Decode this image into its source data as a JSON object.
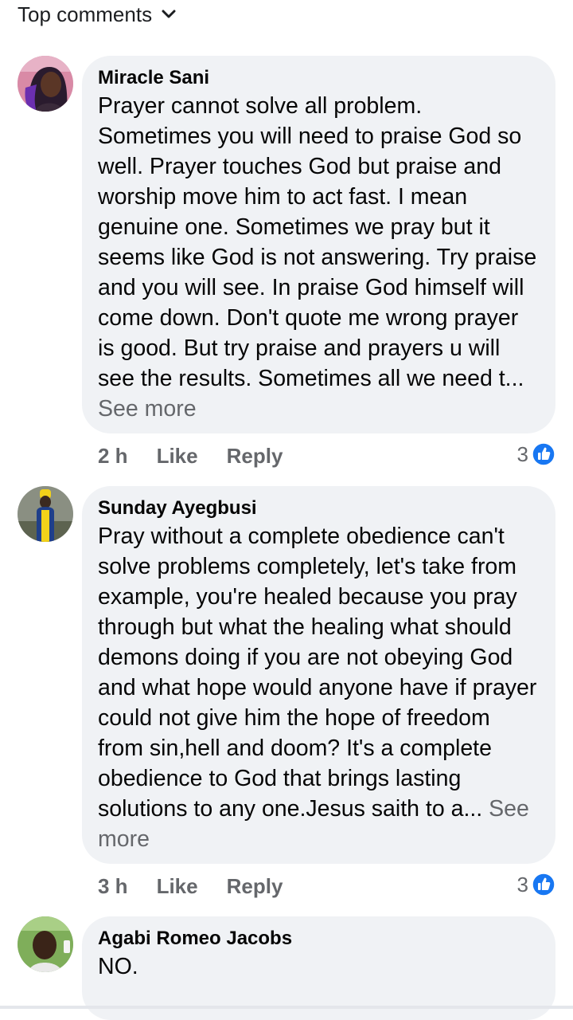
{
  "header": {
    "sort_label": "Top comments"
  },
  "comments": [
    {
      "author": "Miracle Sani",
      "text": "Prayer cannot solve all problem. Sometimes you will need to praise God so well. Prayer touches God but praise and worship move him to act fast. I mean genuine one. Sometimes we pray but it seems like God is not answering. Try praise and you will see. In praise God himself will come down. Don't quote me wrong prayer is good. But try praise and prayers u will see the results. Sometimes all we need t...",
      "see_more": "See more",
      "time": "2 h",
      "like_label": "Like",
      "reply_label": "Reply",
      "reaction_count": "3"
    },
    {
      "author": "Sunday Ayegbusi",
      "text": "Pray without a complete obedience can't solve problems completely, let's take from example, you're healed because you pray through but what the healing what should demons doing if you are not obeying God and what hope would anyone have if prayer could not give him the hope of freedom from sin,hell and doom? It's a complete obedience to God that brings lasting solutions to any one.Jesus saith to a...",
      "see_more": "See more",
      "time": "3 h",
      "like_label": "Like",
      "reply_label": "Reply",
      "reaction_count": "3"
    },
    {
      "author": "Agabi Romeo Jacobs",
      "text": "NO."
    }
  ],
  "colors": {
    "bubble": "#f0f2f5",
    "secondary_text": "#65676b",
    "like_blue": "#1877f2"
  },
  "icons": {
    "sort": "chevron-down-icon",
    "reaction": "thumbs-up-icon"
  }
}
